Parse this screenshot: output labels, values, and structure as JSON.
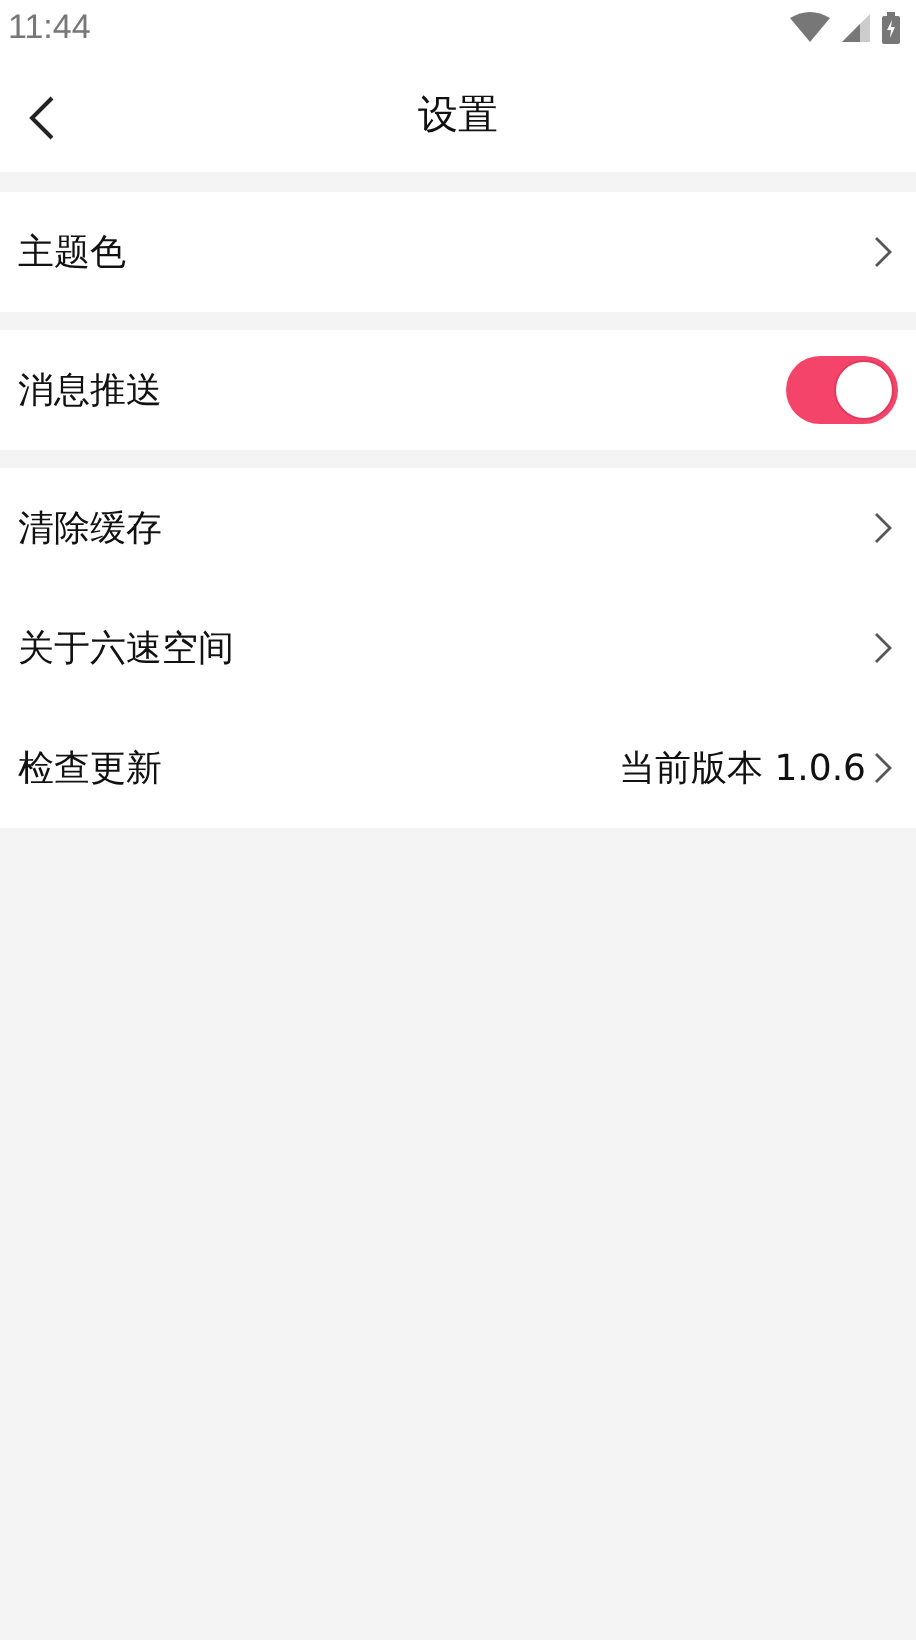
{
  "status_bar": {
    "time": "11:44"
  },
  "header": {
    "title": "设置"
  },
  "groups": [
    {
      "items": [
        {
          "kind": "link",
          "label": "主题色"
        }
      ]
    },
    {
      "items": [
        {
          "kind": "toggle",
          "label": "消息推送",
          "on": true
        }
      ]
    },
    {
      "items": [
        {
          "kind": "link",
          "label": "清除缓存"
        },
        {
          "kind": "link",
          "label": "关于六速空间"
        },
        {
          "kind": "link",
          "label": "检查更新",
          "value": "当前版本 1.0.6"
        }
      ]
    }
  ]
}
